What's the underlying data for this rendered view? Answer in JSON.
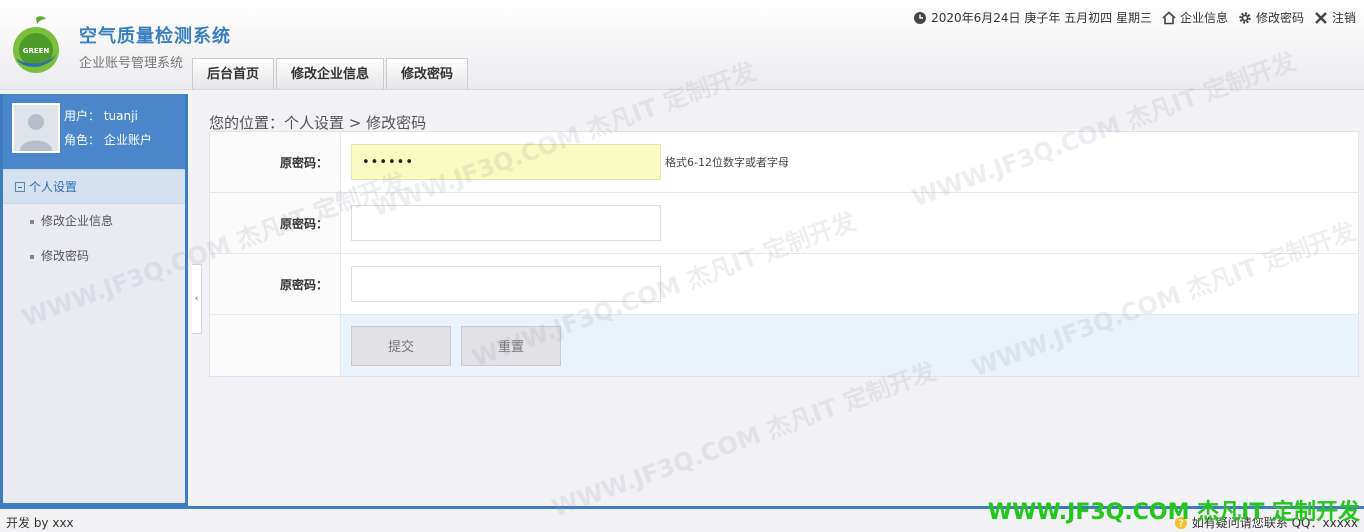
{
  "header": {
    "title": "空气质量检测系统",
    "subtitle": "企业账号管理系统",
    "logo_text": "GREEN",
    "nav": [
      {
        "label": "后台首页"
      },
      {
        "label": "修改企业信息"
      },
      {
        "label": "修改密码"
      }
    ],
    "topbar": {
      "date": "2020年6月24日 庚子年 五月初四 星期三",
      "company_info": "企业信息",
      "change_password": "修改密码",
      "logout": "注销"
    }
  },
  "sidebar": {
    "user_label": "用户：",
    "user_name": "tuanji",
    "role_label": "角色：",
    "role_name": "企业账户",
    "group_title": "个人设置",
    "items": [
      {
        "label": "修改企业信息"
      },
      {
        "label": "修改密码"
      }
    ],
    "collapse_glyph": "‹"
  },
  "main": {
    "breadcrumb": "您的位置：个人设置  >  修改密码",
    "fields": [
      {
        "label": "原密码：",
        "value": "••••••",
        "hint": "格式6-12位数字或者字母"
      },
      {
        "label": "原密码：",
        "value": ""
      },
      {
        "label": "原密码：",
        "value": ""
      }
    ],
    "submit_label": "提交",
    "reset_label": "重置"
  },
  "footer": {
    "left": "开发 by xxx",
    "right": "如有疑问请您联系 QQ：xxxxx"
  },
  "watermark": {
    "text": "WWW.JF3Q.COM 杰凡IT 定制开发"
  },
  "colors": {
    "accent": "#3e7cc0",
    "title": "#3b7fc0",
    "filled_input": "#f8fbc2",
    "watermark_green": "#25c51e"
  }
}
